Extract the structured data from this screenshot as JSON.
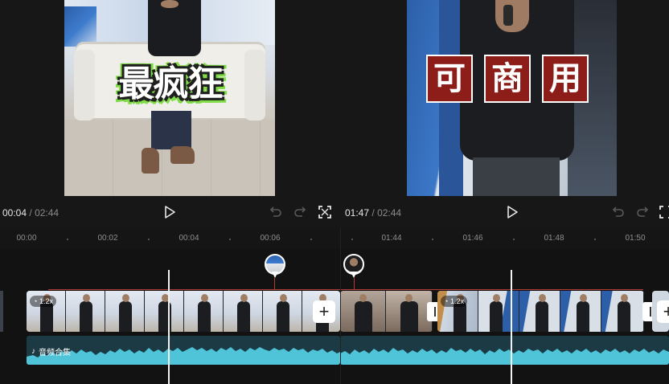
{
  "left": {
    "caption": "最疯狂",
    "time_current": "00:04",
    "time_separator": "/",
    "time_total": "02:44",
    "ruler_labels": [
      "00:00",
      "00:02",
      "00:04",
      "00:06"
    ],
    "speed_badge": "1.2x"
  },
  "right": {
    "caption_chars": [
      "可",
      "商",
      "用"
    ],
    "time_current": "01:47",
    "time_separator": "/",
    "time_total": "02:44",
    "ruler_labels": [
      "01:44",
      "01:46",
      "01:48",
      "01:50"
    ],
    "speed_badge": "1.2x"
  },
  "audio_track": {
    "label": "音频合集",
    "color": "#4fc3d8"
  },
  "icons": {
    "play": "play-icon",
    "undo": "undo-icon",
    "redo": "redo-icon",
    "fullscreen": "fullscreen-icon",
    "add": "plus-icon",
    "music": "music-note-icon",
    "speed": "speed-icon"
  },
  "add_label": "+",
  "colors": {
    "background": "#101010",
    "marker_line": "#b43b36",
    "caption_green": "#7fdc45",
    "caption_red": "#8c1d18",
    "playhead": "#f2f2f2"
  }
}
